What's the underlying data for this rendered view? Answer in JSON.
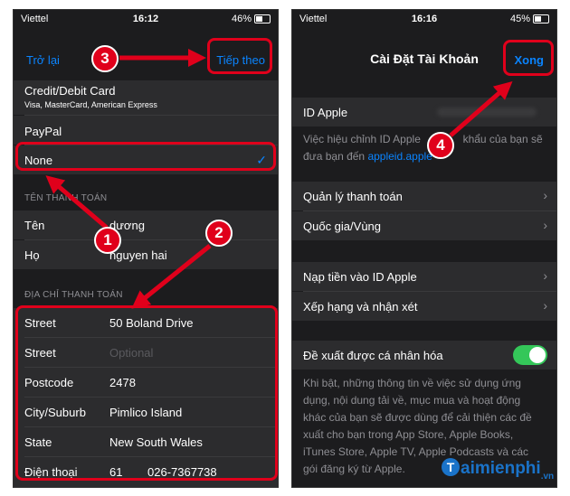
{
  "left": {
    "status": {
      "carrier": "Viettel",
      "time": "16:12",
      "battery": "46%"
    },
    "nav": {
      "back": "Trở lại",
      "title_partial": "...",
      "next": "Tiếp theo"
    },
    "payment_options": [
      {
        "label": "Credit/Debit Card",
        "sub": "Visa, MasterCard, American Express"
      },
      {
        "label": "PayPal"
      },
      {
        "label": "None",
        "selected": true
      }
    ],
    "billing_name_header": "TÊN THANH TOÁN",
    "name_rows": [
      {
        "label": "Tên",
        "value": "dương"
      },
      {
        "label": "Họ",
        "value": "nguyen hai"
      }
    ],
    "address_header": "ĐỊA CHỈ THANH TOÁN",
    "address_rows": [
      {
        "label": "Street",
        "value": "50 Boland Drive"
      },
      {
        "label": "Street",
        "placeholder": "Optional"
      },
      {
        "label": "Postcode",
        "value": "2478"
      },
      {
        "label": "City/Suburb",
        "value": "Pimlico Island"
      },
      {
        "label": "State",
        "value": "New South Wales"
      },
      {
        "label": "Điện thoại",
        "code": "61",
        "value": "026-7367738"
      }
    ]
  },
  "right": {
    "status": {
      "carrier": "Viettel",
      "time": "16:16",
      "battery": "45%"
    },
    "nav": {
      "title": "Cài Đặt Tài Khoản",
      "done": "Xong"
    },
    "apple_id_label": "ID Apple",
    "apple_id_note_1": "Việc hiệu chỉnh ID Apple",
    "apple_id_note_2": "khẩu của bạn sẽ",
    "apple_id_note_3": "đưa bạn đến",
    "apple_id_link": "appleid.apple",
    "rows_group1": [
      {
        "label": "Quản lý thanh toán"
      },
      {
        "label": "Quốc gia/Vùng"
      }
    ],
    "rows_group2": [
      {
        "label": "Nạp tiền vào ID Apple"
      },
      {
        "label": "Xếp hạng và nhận xét"
      }
    ],
    "personalize_label": "Đề xuất được cá nhân hóa",
    "personalize_note": "Khi bật, những thông tin về việc sử dụng ứng dụng, nội dung tải về, mục mua và hoạt động khác của bạn sẽ được dùng để cải thiện các đề xuất cho bạn trong App Store, Apple Books, iTunes Store, Apple TV, Apple Podcasts và các gói đăng ký từ Apple."
  },
  "badges": [
    "1",
    "2",
    "3",
    "4"
  ],
  "logo": {
    "letter": "T",
    "text": "aimienphi",
    "suffix": ".vn"
  },
  "colors": {
    "annotation": "#e0001b",
    "link": "#0a84ff",
    "toggle": "#34c759"
  }
}
